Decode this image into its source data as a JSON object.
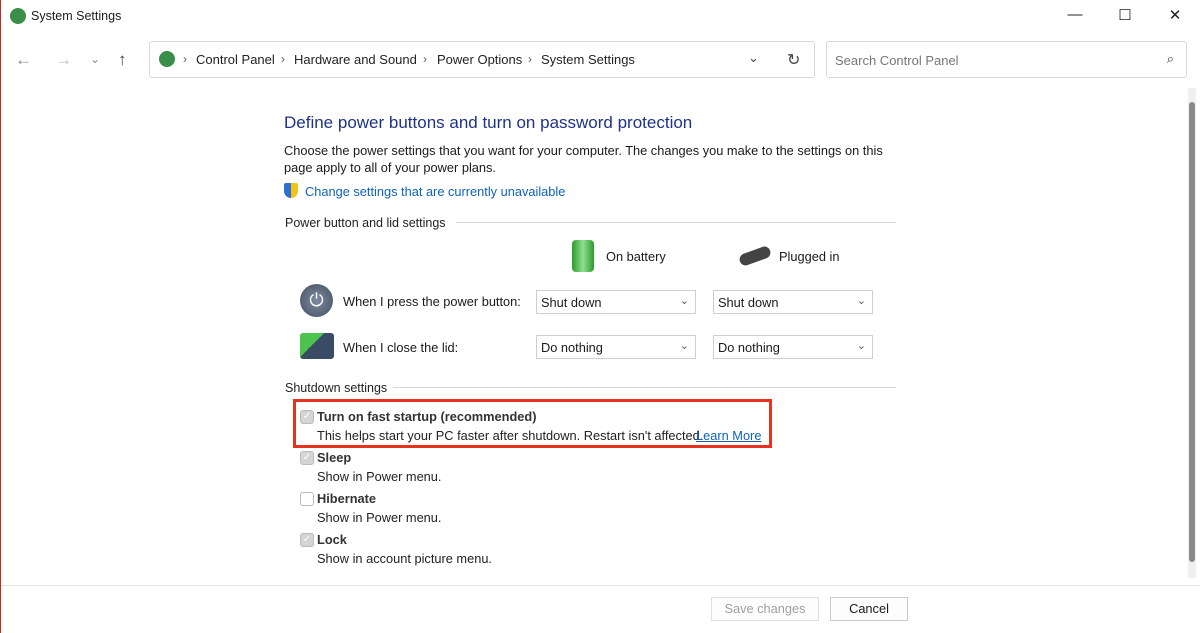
{
  "window": {
    "title": "System Settings",
    "controls": {
      "minimize": "—",
      "maximize": "☐",
      "close": "✕"
    }
  },
  "nav": {
    "back": "←",
    "forward": "→",
    "recent": "⌄",
    "up": "↑"
  },
  "breadcrumb": [
    "Control Panel",
    "Hardware and Sound",
    "Power Options",
    "System Settings"
  ],
  "search": {
    "placeholder": "Search Control Panel"
  },
  "main": {
    "heading": "Define power buttons and turn on password protection",
    "description": "Choose the power settings that you want for your computer. The changes you make to the settings on this page apply to all of your power plans.",
    "change_link": "Change settings that are currently unavailable",
    "power_section": "Power button and lid settings",
    "col_battery": "On battery",
    "col_plugged": "Plugged in",
    "rows": [
      {
        "label": "When I press the power button:",
        "battery": "Shut down",
        "plugged": "Shut down"
      },
      {
        "label": "When I close the lid:",
        "battery": "Do nothing",
        "plugged": "Do nothing"
      }
    ],
    "shutdown_section": "Shutdown settings",
    "options": [
      {
        "label": "Turn on fast startup (recommended)",
        "desc": "This helps start your PC faster after shutdown. Restart isn't affected.",
        "link": "Learn More",
        "checked": true
      },
      {
        "label": "Sleep",
        "desc": "Show in Power menu.",
        "checked": true
      },
      {
        "label": "Hibernate",
        "desc": "Show in Power menu.",
        "checked": false
      },
      {
        "label": "Lock",
        "desc": "Show in account picture menu.",
        "checked": true
      }
    ],
    "highlight_color": "#e8321e"
  },
  "footer": {
    "save": "Save changes",
    "cancel": "Cancel"
  }
}
